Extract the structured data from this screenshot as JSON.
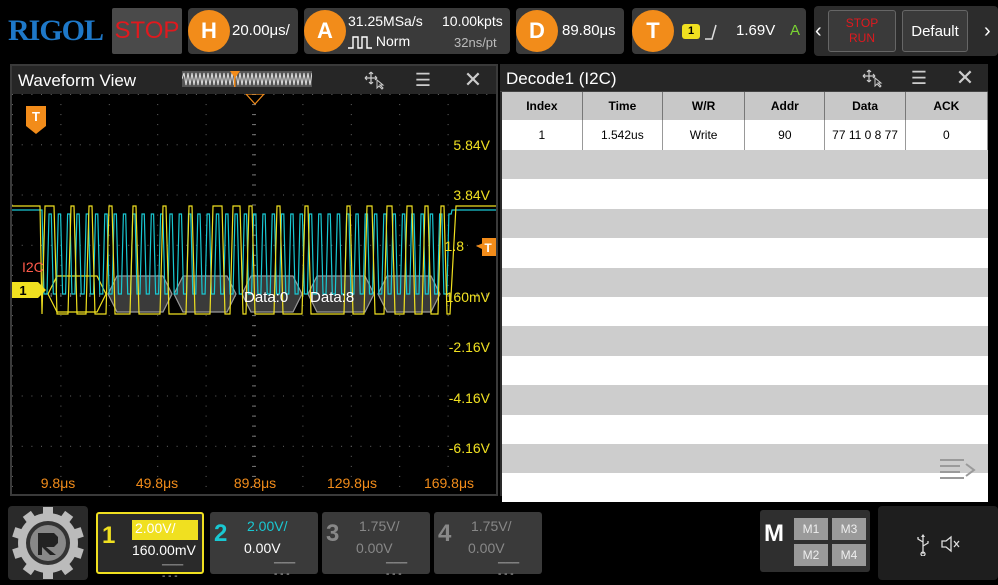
{
  "topbar": {
    "brand": "RIGOL",
    "run_state": "STOP",
    "horizontal": {
      "badge": "H",
      "value": "20.00μs/"
    },
    "acquire": {
      "badge": "A",
      "sample_rate": "31.25MSa/s",
      "mode": "Norm",
      "memory_depth": "10.00kpts",
      "resolution": "32ns/pt"
    },
    "delay": {
      "badge": "D",
      "value": "89.80μs"
    },
    "trigger": {
      "badge": "T",
      "channel": "1",
      "level": "1.69V",
      "mode": "A"
    },
    "stop_run": {
      "line1": "STOP",
      "line2": "RUN"
    },
    "default_label": "Default"
  },
  "waveform_view": {
    "title": "Waveform View",
    "trigger_marker": "T",
    "channel_marker": "1",
    "bus_label": "I2C",
    "bus_data_labels": [
      "Data:0",
      "Data:8"
    ],
    "y_labels": [
      "5.84V",
      "3.84V",
      "1.8",
      "160mV",
      "-2.16V",
      "-4.16V",
      "-6.16V"
    ],
    "x_labels": [
      "9.8μs",
      "49.8μs",
      "89.8μs",
      "129.8μs",
      "169.8μs"
    ],
    "trigger_level_marker": "T"
  },
  "decode": {
    "title": "Decode1 (I2C)",
    "columns": [
      "Index",
      "Time",
      "W/R",
      "Addr",
      "Data",
      "ACK"
    ],
    "rows": [
      [
        "1",
        "1.542us",
        "Write",
        "90",
        "77 11 0 8 77",
        "0"
      ]
    ]
  },
  "channels": [
    {
      "num": "1",
      "scale": "2.00V/",
      "offset": "160.00mV",
      "color": "#f0e020",
      "active": true
    },
    {
      "num": "2",
      "scale": "2.00V/",
      "offset": "0.00V",
      "color": "#19c8d2",
      "active": false
    },
    {
      "num": "3",
      "scale": "1.75V/",
      "offset": "0.00V",
      "color": "#888888",
      "active": false
    },
    {
      "num": "4",
      "scale": "1.75V/",
      "offset": "0.00V",
      "color": "#888888",
      "active": false
    }
  ],
  "math": {
    "letter": "M",
    "buttons": [
      "M1",
      "M3",
      "M2",
      "M4"
    ]
  },
  "colors": {
    "ch1": "#f0e020",
    "ch2": "#19c8d2",
    "accent": "#f28c1a",
    "stop": "#e0191e",
    "brand": "#1e78c8"
  }
}
